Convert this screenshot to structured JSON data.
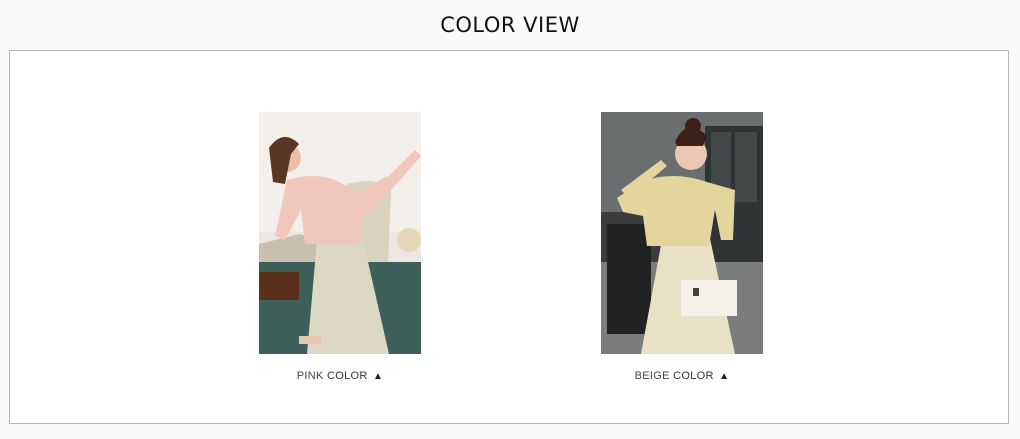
{
  "header": {
    "title": "COLOR VIEW"
  },
  "colors": [
    {
      "name": "PINK",
      "suffix": "COLOR",
      "icon": "triangle-up-icon",
      "swatch": "#f2c7bb"
    },
    {
      "name": "BEIGE",
      "suffix": "COLOR",
      "icon": "triangle-up-icon",
      "swatch": "#e7ddb6"
    }
  ]
}
